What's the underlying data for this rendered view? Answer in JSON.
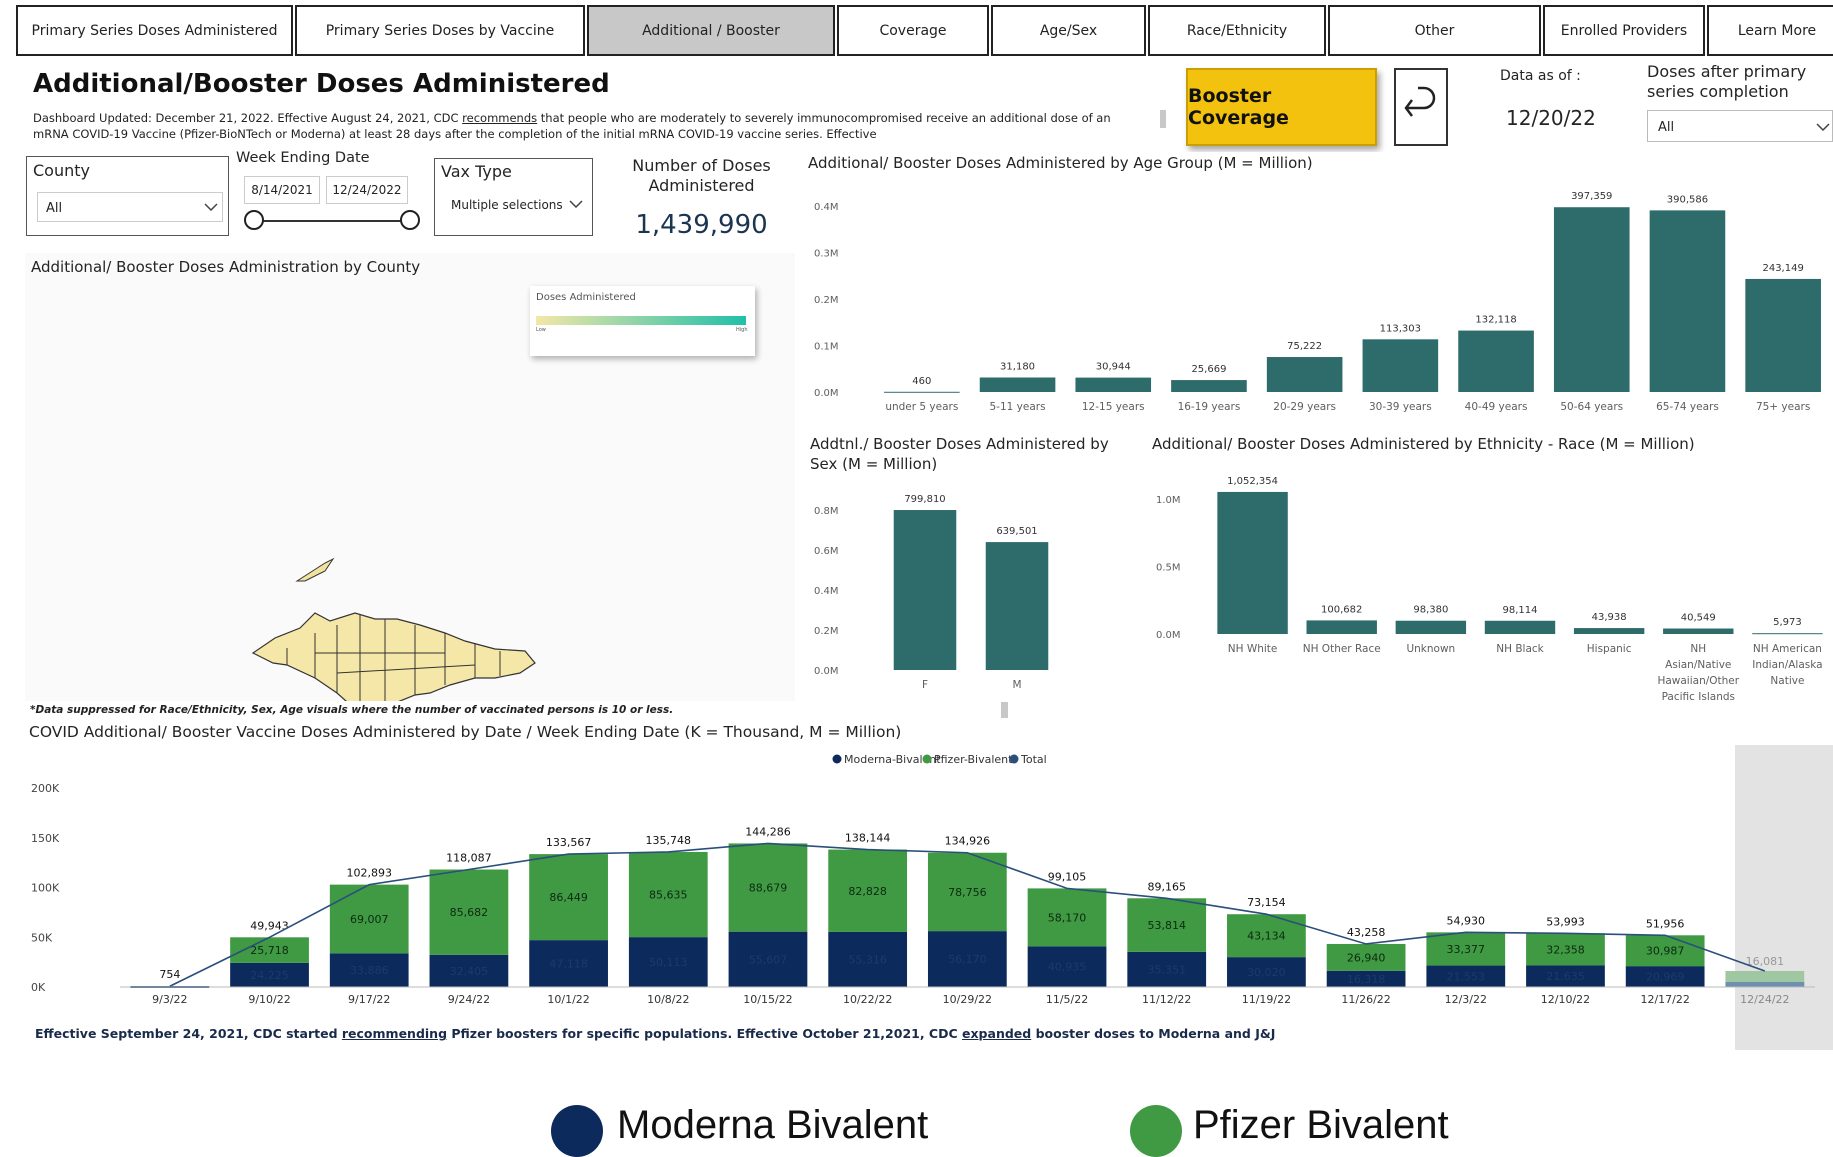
{
  "tabs": [
    "Primary Series Doses Administered",
    "Primary Series Doses by Vaccine",
    "Additional / Booster",
    "Coverage",
    "Age/Sex",
    "Race/Ethnicity",
    "Other",
    "Enrolled Providers",
    "Learn More"
  ],
  "header": {
    "title": "Additional/Booster Doses Administered",
    "desc_prefix": "Dashboard Updated: December 21, 2022. Effective August 24, 2021, CDC ",
    "desc_link": "recommends",
    "desc_suffix": " that people who are moderately to severely immunocompromised receive an additional dose of an mRNA COVID-19 Vaccine (Pfizer-BioNTech or Moderna) at least 28 days after the completion of the initial mRNA COVID-19 vaccine series. Effective",
    "booster_button": "Booster Coverage",
    "back_icon": "undo-arrow-icon",
    "data_as_of_label": "Data as of :",
    "data_as_of_value": "12/20/22",
    "doses_after_label": "Doses after primary series completion",
    "doses_after_value": "All"
  },
  "filters": {
    "county_label": "County",
    "county_value": "All",
    "week_label": "Week Ending Date",
    "week_start": "8/14/2021",
    "week_end": "12/24/2022",
    "vax_label": "Vax Type",
    "vax_value": "Multiple selections"
  },
  "kpi": {
    "label": "Number of Doses Administered",
    "value": "1,439,990"
  },
  "map": {
    "title": "Additional/ Booster Doses Administration by County",
    "legend_title": "Doses Administered",
    "legend_low": "Low",
    "legend_high": "High"
  },
  "colors": {
    "teal": "#2e6b6b",
    "moderna": "#0d2a5c",
    "pfizer": "#3f9a43",
    "total": "#2a4f7c",
    "gold": "#f2c20f"
  },
  "age_chart": {
    "title": "Additional/ Booster Doses Administered by Age Group (M = Million)",
    "chart_data": {
      "type": "bar",
      "categories": [
        "under 5 years",
        "5-11 years",
        "12-15 years",
        "16-19 years",
        "20-29 years",
        "30-39 years",
        "40-49 years",
        "50-64 years",
        "65-74 years",
        "75+ years"
      ],
      "values": [
        460,
        31180,
        30944,
        25669,
        75222,
        113303,
        132118,
        397359,
        390586,
        243149
      ],
      "value_labels": [
        "460",
        "31,180",
        "30,944",
        "25,669",
        "75,222",
        "113,303",
        "132,118",
        "397,359",
        "390,586",
        "243,149"
      ],
      "yticks": [
        "0.0M",
        "0.1M",
        "0.2M",
        "0.3M",
        "0.4M"
      ],
      "ylim": [
        0,
        400000
      ]
    }
  },
  "sex_chart": {
    "title_line1": "Addtnl./ Booster Doses Administered by",
    "title_line2": "Sex (M = Million)",
    "chart_data": {
      "type": "bar",
      "categories": [
        "F",
        "M"
      ],
      "values": [
        799810,
        639501
      ],
      "value_labels": [
        "799,810",
        "639,501"
      ],
      "yticks": [
        "0.0M",
        "0.2M",
        "0.4M",
        "0.6M",
        "0.8M"
      ],
      "ylim": [
        0,
        800000
      ]
    }
  },
  "race_chart": {
    "title": "Additional/ Booster Doses Administered by Ethnicity - Race (M = Million)",
    "chart_data": {
      "type": "bar",
      "categories": [
        [
          "NH White"
        ],
        [
          "NH Other Race"
        ],
        [
          "Unknown"
        ],
        [
          "NH Black"
        ],
        [
          "Hispanic"
        ],
        [
          "NH",
          "Asian/Native",
          "Hawaiian/Other",
          "Pacific Islands"
        ],
        [
          "NH American",
          "Indian/Alaska",
          "Native"
        ]
      ],
      "values": [
        1052354,
        100682,
        98380,
        98114,
        43938,
        40549,
        5973
      ],
      "value_labels": [
        "1,052,354",
        "100,682",
        "98,380",
        "98,114",
        "43,938",
        "40,549",
        "5,973"
      ],
      "yticks": [
        "0.0M",
        "0.5M",
        "1.0M"
      ],
      "ylim": [
        0,
        1000000
      ]
    }
  },
  "suppression_note": "*Data suppressed for Race/Ethnicity, Sex, Age visuals where the number of vaccinated persons is 10 or less.",
  "date_chart": {
    "title": "COVID Additional/ Booster Vaccine Doses Administered by Date / Week Ending Date (K = Thousand, M = Million)",
    "legend": [
      "Moderna-Bivalent",
      "Pfizer-Bivalent",
      "Total"
    ],
    "chart_data": {
      "type": "bar",
      "categories": [
        "9/3/22",
        "9/10/22",
        "9/17/22",
        "9/24/22",
        "10/1/22",
        "10/8/22",
        "10/15/22",
        "10/22/22",
        "10/29/22",
        "11/5/22",
        "11/12/22",
        "11/19/22",
        "11/26/22",
        "12/3/22",
        "12/10/22",
        "12/17/22",
        "12/24/22"
      ],
      "series": [
        {
          "name": "Moderna-Bivalent",
          "values": [
            0,
            24225,
            33886,
            32405,
            47118,
            50113,
            55607,
            55316,
            56170,
            40935,
            35351,
            30020,
            16318,
            21553,
            21635,
            20969,
            0
          ]
        },
        {
          "name": "Pfizer-Bivalent",
          "values": [
            0,
            25718,
            69007,
            85682,
            86449,
            85635,
            88679,
            82828,
            78756,
            58170,
            53814,
            43134,
            26940,
            33377,
            32358,
            30987,
            16081
          ]
        },
        {
          "name": "Total",
          "values": [
            754,
            49943,
            102893,
            118087,
            133567,
            135748,
            144286,
            138144,
            134926,
            99105,
            89165,
            73154,
            43258,
            54930,
            53993,
            51956,
            16081
          ]
        }
      ],
      "yticks": [
        "0K",
        "50K",
        "100K",
        "150K",
        "200K"
      ],
      "ylim": [
        0,
        200000
      ]
    },
    "footer_a": "Effective September 24, 2021, CDC started ",
    "footer_link1": "recommending",
    "footer_b": " Pfizer boosters for specific populations. Effective October 21,2021, CDC ",
    "footer_link2": "expanded",
    "footer_c": " booster doses to Moderna and J&J"
  },
  "big_legend": {
    "moderna": "Moderna Bivalent",
    "pfizer": "Pfizer Bivalent"
  }
}
